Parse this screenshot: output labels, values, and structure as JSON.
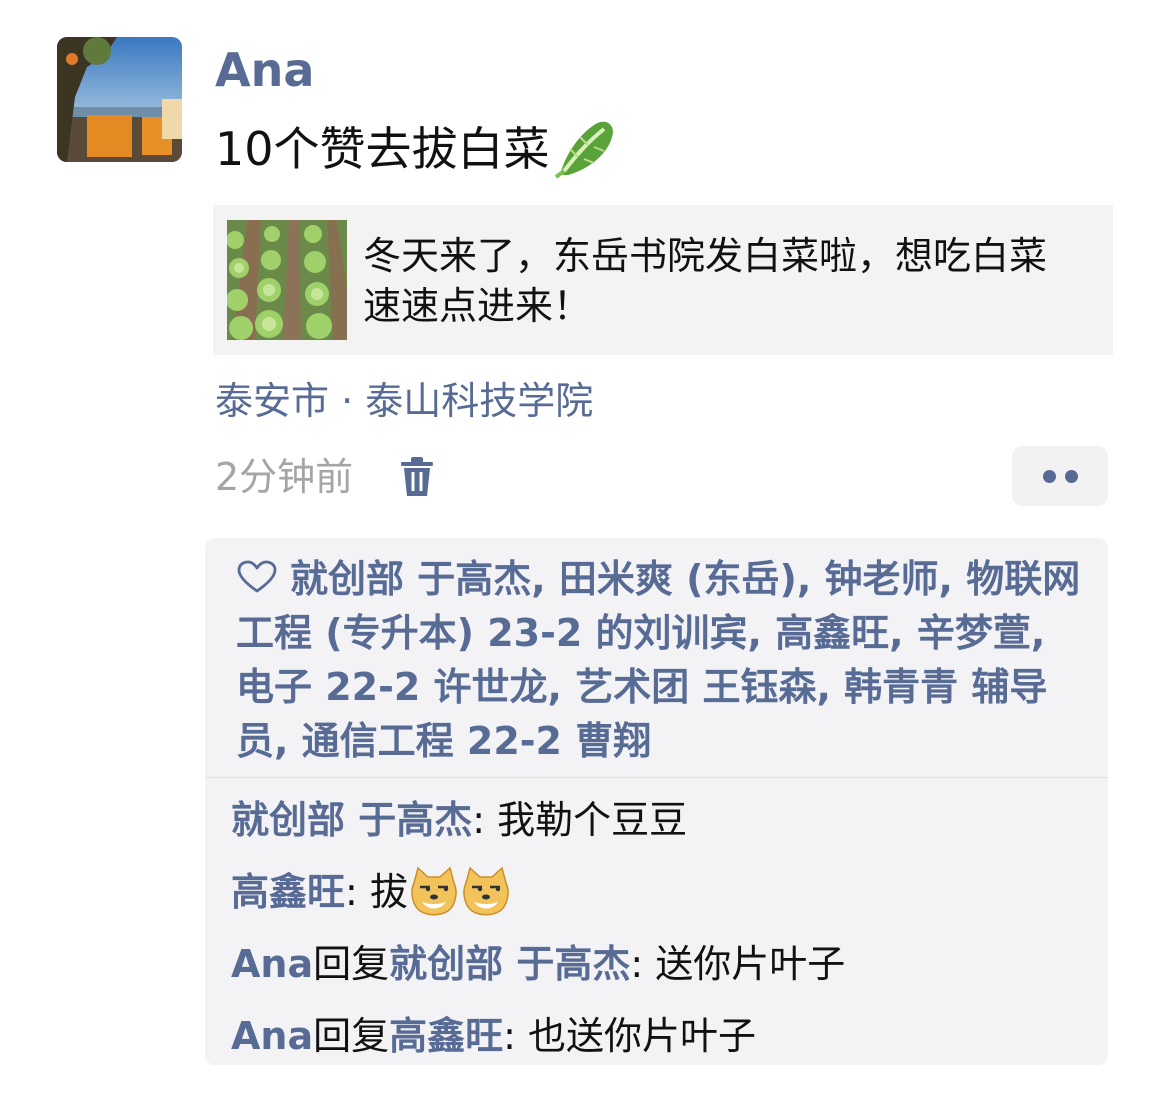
{
  "post": {
    "author": "Ana",
    "text": "10个赞去拔白菜",
    "text_emoji": "cabbage-icon",
    "link": {
      "title": "冬天来了，东岳书院发白菜啦，想吃白菜速速点进来！"
    },
    "location": "泰安市 · 泰山科技学院",
    "time": "2分钟前"
  },
  "likes": {
    "icon": "heart-outline-icon",
    "names": "就创部 于高杰, 田米爽 (东岳), 钟老师, 物联网工程 (专升本) 23-2 的刘训宾, 高鑫旺, 辛梦萱, 电子 22-2 许世龙, 艺术团 王钰森, 韩青青 辅导员, 通信工程 22-2 曹翔"
  },
  "comments": [
    {
      "user": "就创部 于高杰",
      "separator": ": ",
      "text": "我勒个豆豆"
    },
    {
      "user": "高鑫旺",
      "separator": ": ",
      "text": "拔",
      "emoji": "doge-emoji"
    },
    {
      "user": "Ana",
      "reply_word": "回复",
      "target": "就创部 于高杰",
      "separator": ": ",
      "text": "送你片叶子"
    },
    {
      "user": "Ana",
      "reply_word": "回复",
      "target": "高鑫旺",
      "separator": ": ",
      "text": "也送你片叶子"
    }
  ],
  "colors": {
    "link_blue": "#576b95",
    "meta_gray": "#a5a5a5",
    "panel_bg": "#f3f3f5"
  }
}
